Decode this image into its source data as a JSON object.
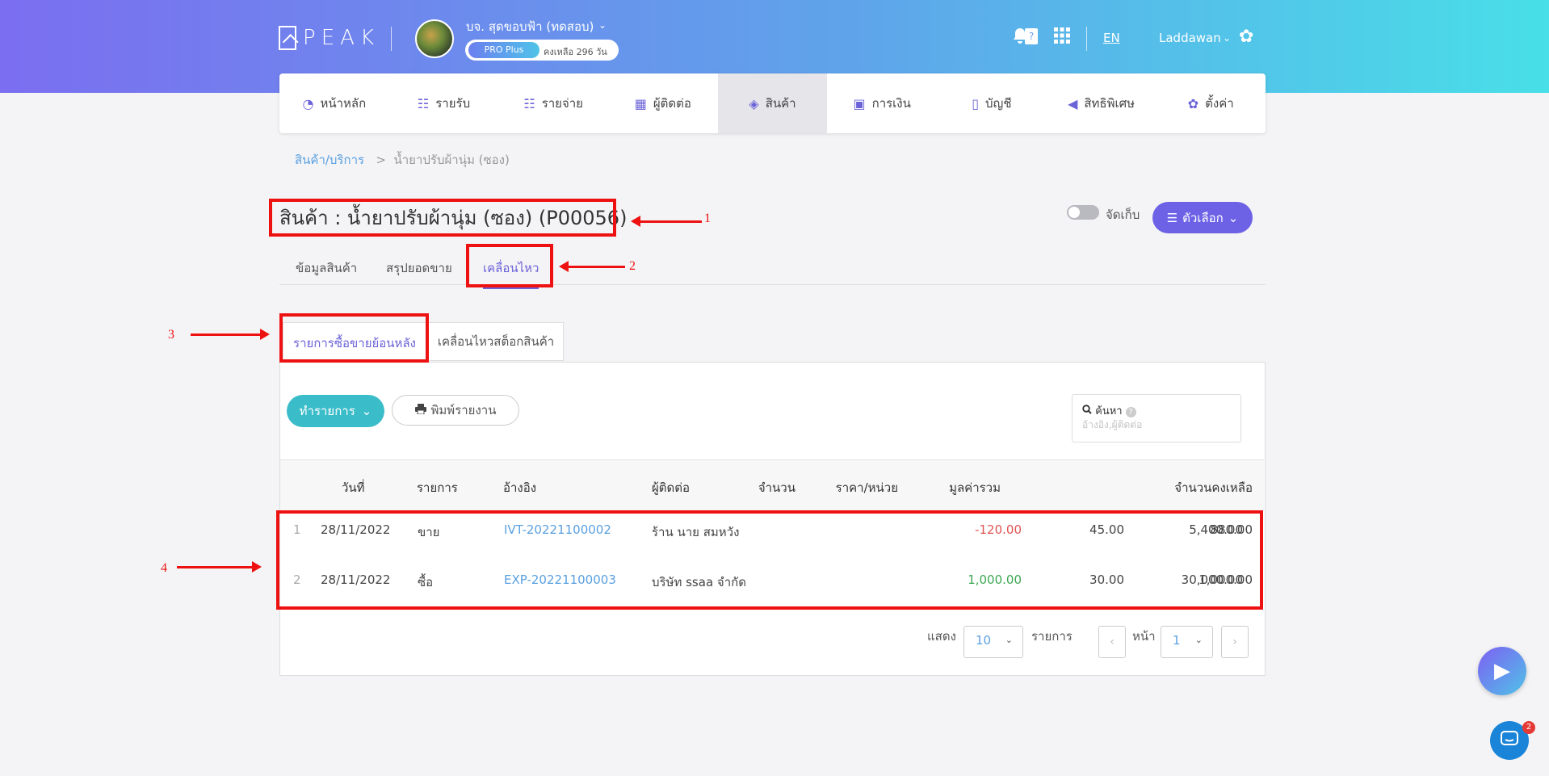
{
  "header": {
    "logo": "PEAK",
    "company": "บจ. สุดขอบฟ้า (ทดสอบ)",
    "plan": "PRO Plus",
    "days_left": "คงเหลือ 296 วัน",
    "lang": "EN",
    "user": "Laddawan",
    "icons": [
      "bell-icon",
      "help-book-icon",
      "apps-grid-icon"
    ]
  },
  "nav": [
    {
      "label": "หน้าหลัก",
      "icon": "dashboard-icon"
    },
    {
      "label": "รายรับ",
      "icon": "income-icon"
    },
    {
      "label": "รายจ่าย",
      "icon": "expense-icon"
    },
    {
      "label": "ผู้ติดต่อ",
      "icon": "contacts-icon"
    },
    {
      "label": "สินค้า",
      "icon": "box-icon"
    },
    {
      "label": "การเงิน",
      "icon": "money-icon"
    },
    {
      "label": "บัญชี",
      "icon": "book-icon"
    },
    {
      "label": "สิทธิพิเศษ",
      "icon": "megaphone-icon"
    },
    {
      "label": "ตั้งค่า",
      "icon": "gear-icon"
    }
  ],
  "breadcrumb": {
    "root": "สินค้า/บริการ",
    "sep": ">",
    "current": "น้ำยาปรับผ้านุ่ม (ซอง)"
  },
  "page": {
    "title": "สินค้า : น้ำยาปรับผ้านุ่ม (ซอง) (P00056)",
    "archive_label": "จัดเก็บ",
    "options_label": "ตัวเลือก"
  },
  "tabs": [
    "ข้อมูลสินค้า",
    "สรุปยอดขาย",
    "เคลื่อนไหว"
  ],
  "subtabs": [
    "รายการซื้อขายย้อนหลัง",
    "เคลื่อนไหวสต็อกสินค้า"
  ],
  "toolbar": {
    "action_label": "ทำรายการ",
    "print_label": "พิมพ์รายงาน",
    "search_label": "ค้นหา",
    "search_placeholder": "อ้างอิง,ผู้ติดต่อ",
    "search_value": ""
  },
  "table": {
    "headers": [
      "วันที่",
      "รายการ",
      "อ้างอิง",
      "ผู้ติดต่อ",
      "จำนวน",
      "ราคา/หน่วย",
      "มูลค่ารวม",
      "จำนวนคงเหลือ"
    ],
    "rows": [
      {
        "no": "1",
        "date": "28/11/2022",
        "type": "ขาย",
        "ref": "IVT-20221100002",
        "contact": "ร้าน นาย สมหวัง",
        "qty": "-120.00",
        "price": "45.00",
        "total": "5,400.00",
        "balance": "880.00"
      },
      {
        "no": "2",
        "date": "28/11/2022",
        "type": "ซื้อ",
        "ref": "EXP-20221100003",
        "contact": "บริษัท ssaa จำกัด",
        "qty": "1,000.00",
        "price": "30.00",
        "total": "30,000.00",
        "balance": "1,000.00"
      }
    ]
  },
  "pagination": {
    "show_label": "แสดง",
    "page_size": "10",
    "items_label": "รายการ",
    "page_label": "หน้า",
    "page": "1"
  },
  "annotations": [
    "1",
    "2",
    "3",
    "4"
  ],
  "chat_badge": "2",
  "colors": {
    "accent": "#6d62e6",
    "teal": "#3bbcc9",
    "link": "#5aa0e0",
    "negative": "#e05454",
    "positive": "#3ca852",
    "annotation": "#ee1111"
  }
}
